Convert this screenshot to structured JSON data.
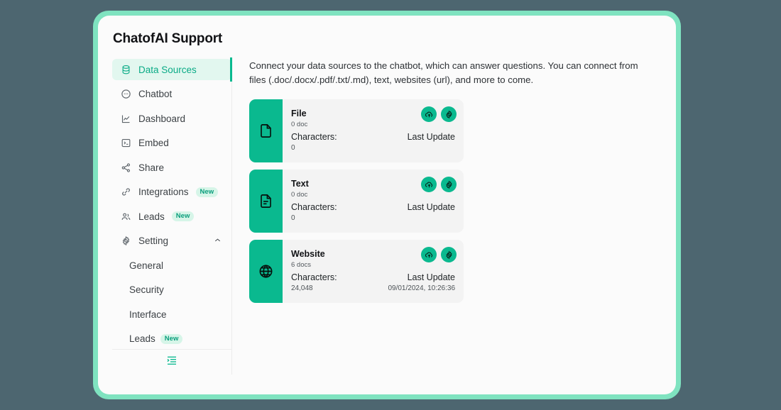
{
  "window": {
    "title": "ChatofAI Support"
  },
  "sidebar": {
    "items": [
      {
        "label": "Data Sources",
        "icon": "database-icon",
        "active": true
      },
      {
        "label": "Chatbot",
        "icon": "chat-bubble-icon"
      },
      {
        "label": "Dashboard",
        "icon": "chart-icon"
      },
      {
        "label": "Embed",
        "icon": "terminal-icon"
      },
      {
        "label": "Share",
        "icon": "share-icon"
      },
      {
        "label": "Integrations",
        "icon": "link-icon",
        "badge": "New"
      },
      {
        "label": "Leads",
        "icon": "people-icon",
        "badge": "New"
      },
      {
        "label": "Setting",
        "icon": "gear-icon",
        "expanded": true
      }
    ],
    "sub_items": [
      {
        "label": "General"
      },
      {
        "label": "Security"
      },
      {
        "label": "Interface"
      },
      {
        "label": "Leads",
        "badge": "New"
      }
    ],
    "footer_icon": "collapse-menu-icon"
  },
  "main": {
    "description": "Connect your data sources to the chatbot, which can answer questions. You can connect from files (.doc/.docx/.pdf/.txt/.md), text, websites (url), and more to come.",
    "characters_label": "Characters:",
    "last_update_label": "Last Update",
    "cards": [
      {
        "title": "File",
        "docs": "0 doc",
        "characters": "0",
        "last_update": "",
        "icon": "file-icon"
      },
      {
        "title": "Text",
        "docs": "0 doc",
        "characters": "0",
        "last_update": "",
        "icon": "text-file-icon"
      },
      {
        "title": "Website",
        "docs": "6 docs",
        "characters": "24,048",
        "last_update": "09/01/2024, 10:26:36",
        "icon": "globe-icon"
      }
    ],
    "action_icons": {
      "upload": "cloud-upload-icon",
      "settings": "gear-icon"
    }
  },
  "colors": {
    "accent": "#0ab98f",
    "accent_text": "#0aab86",
    "frame": "#7fe3c0",
    "page_bg": "#4d6670",
    "badge_bg": "#d6f5e8",
    "card_bg": "#f3f3f3"
  }
}
